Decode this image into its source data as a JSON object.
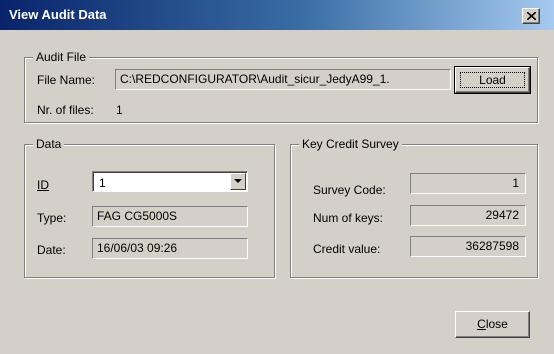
{
  "window": {
    "title": "View Audit Data",
    "close_glyph": "×"
  },
  "audit_file": {
    "legend": "Audit File",
    "file_name_label": "File Name:",
    "file_name_value": "C:\\REDCONFIGURATOR\\Audit_sicur_JedyA99_1.",
    "load_button": "Load",
    "nr_files_label": "Nr. of files:",
    "nr_files_value": "1"
  },
  "data": {
    "legend": "Data",
    "id_label": "ID",
    "id_value": "1",
    "type_label": "Type:",
    "type_value": "FAG CG5000S",
    "date_label": "Date:",
    "date_value": "16/06/03 09:26"
  },
  "key_credit_survey": {
    "legend": "Key Credit Survey",
    "survey_code_label": "Survey Code:",
    "survey_code_value": "1",
    "num_keys_label": "Num of keys:",
    "num_keys_value": "29472",
    "credit_value_label": "Credit value:",
    "credit_value_value": "36287598"
  },
  "close_button": "Close",
  "colors": {
    "face": "#d4d0c8",
    "title_start": "#08246b",
    "title_end": "#a6caf0"
  }
}
